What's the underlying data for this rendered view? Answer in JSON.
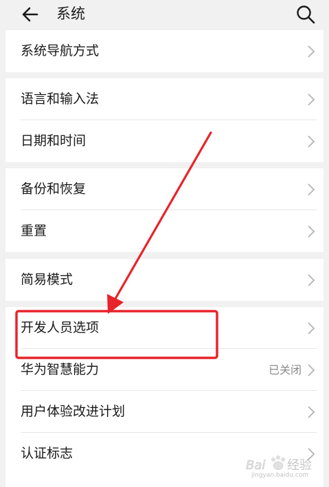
{
  "header": {
    "title": "系统",
    "back_icon": "back-arrow-icon",
    "search_icon": "search-icon"
  },
  "groups": [
    {
      "rows": [
        {
          "label": "系统导航方式"
        }
      ]
    },
    {
      "rows": [
        {
          "label": "语言和输入法"
        },
        {
          "label": "日期和时间"
        }
      ]
    },
    {
      "rows": [
        {
          "label": "备份和恢复"
        },
        {
          "label": "重置"
        }
      ]
    },
    {
      "rows": [
        {
          "label": "简易模式"
        }
      ]
    },
    {
      "rows": [
        {
          "label": "开发人员选项",
          "highlighted": true
        },
        {
          "label": "华为智慧能力",
          "value": "已关闭"
        },
        {
          "label": "用户体验改进计划"
        },
        {
          "label": "认证标志"
        }
      ]
    }
  ],
  "annotation": {
    "highlight_color": "#e8232a",
    "arrow_color": "#e8232a"
  },
  "watermark": {
    "brand": "Baidu",
    "text": "经验",
    "url": "jingyan.baidu.com"
  }
}
